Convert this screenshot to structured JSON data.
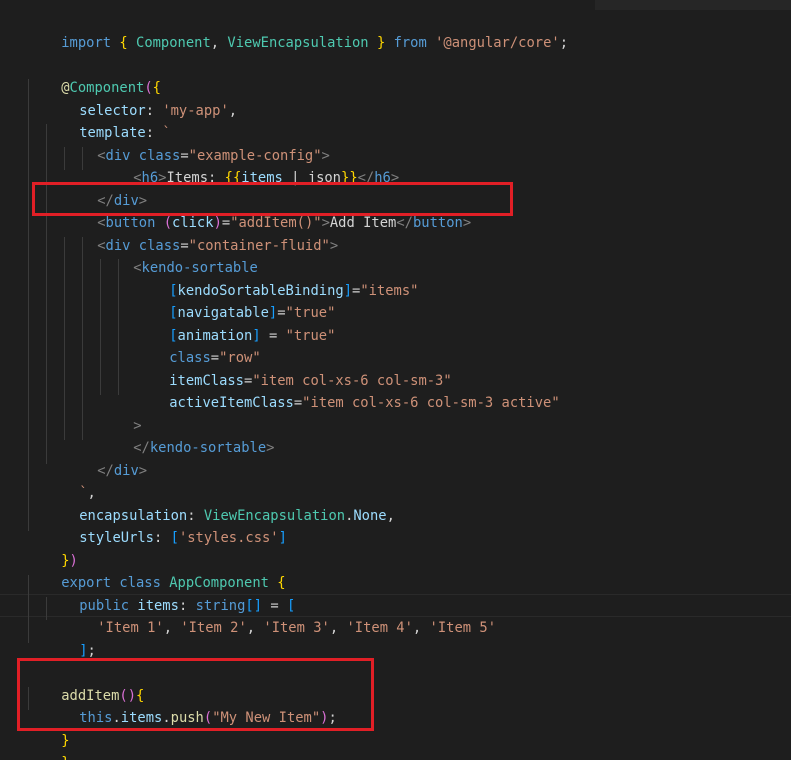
{
  "code_lines": [
    "import { Component, ViewEncapsulation } from '@angular/core';",
    "",
    "@Component({",
    "selector: 'my-app',",
    "template: `",
    "<div class=\"example-config\">",
    "<h6>Items: {{items | json}}</h6>",
    "</div>",
    "<button (click)=\"addItem()\">Add Item</button>",
    "<div class=\"container-fluid\">",
    "<kendo-sortable",
    "[kendoSortableBinding]=\"items\"",
    "[navigatable]=\"true\"",
    "[animation] = \"true\"",
    "class=\"row\"",
    "itemClass=\"item col-xs-6 col-sm-3\"",
    "activeItemClass=\"item col-xs-6 col-sm-3 active\"",
    ">",
    "</kendo-sortable>",
    "</div>",
    "`,",
    "encapsulation: ViewEncapsulation.None,",
    "styleUrls: ['styles.css']",
    "})",
    "export class AppComponent {",
    "public items: string[] = [",
    "'Item 1', 'Item 2', 'Item 3', 'Item 4', 'Item 5'",
    "];",
    "",
    "addItem(){",
    "this.items.push(\"My New Item\");",
    "}",
    "}"
  ],
  "highlights": [
    {
      "name": "button-line-highlight",
      "target": "<button (click)=\"addItem()\">Add Item</button>"
    },
    {
      "name": "additem-method-highlight",
      "target": "addItem(){ this.items.push(\"My New Item\"); }"
    }
  ],
  "colors": {
    "background": "#1e1e1e",
    "highlight_box": "#e11f26",
    "keyword": "#569cd6",
    "string": "#ce9178",
    "property": "#9cdcfe",
    "function": "#dcdcaa",
    "class": "#4ec9b0"
  }
}
